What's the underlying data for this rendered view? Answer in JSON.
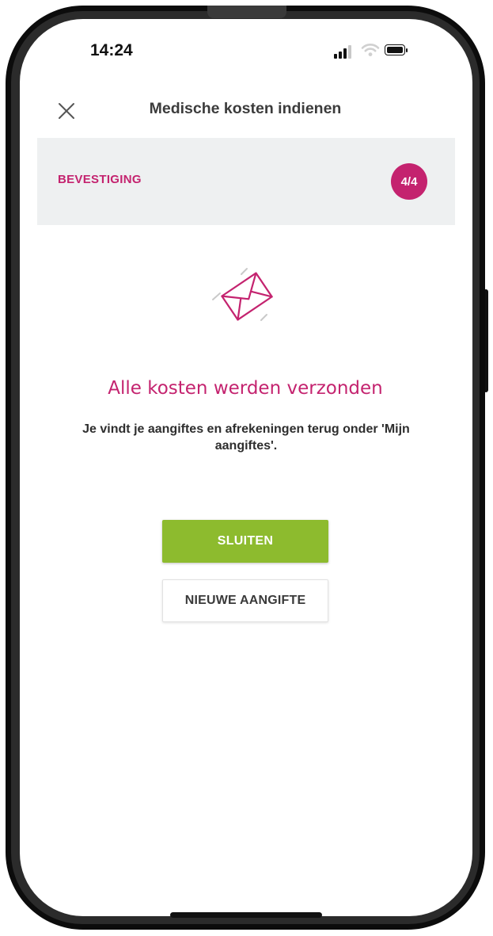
{
  "status_bar": {
    "time": "14:24",
    "icons": [
      "signal-icon",
      "wifi-icon",
      "battery-icon"
    ]
  },
  "header": {
    "close_icon": "close-icon",
    "title": "Medische kosten indienen"
  },
  "stepper": {
    "label": "BEVESTIGING",
    "progress": "4/4",
    "current_step": 4,
    "total_steps": 4
  },
  "confirmation": {
    "illustration_icon": "envelope-icon",
    "headline": "Alle kosten werden verzonden",
    "message": "Je vindt je aangiftes en afrekeningen terug onder 'Mijn aangiftes'."
  },
  "actions": {
    "close_label": "SLUITEN",
    "new_claim_label": "NIEUWE AANGIFTE"
  },
  "colors": {
    "accent": "#c4236f",
    "primary_button": "#8dbb2e",
    "band_background": "#eef0f1"
  }
}
